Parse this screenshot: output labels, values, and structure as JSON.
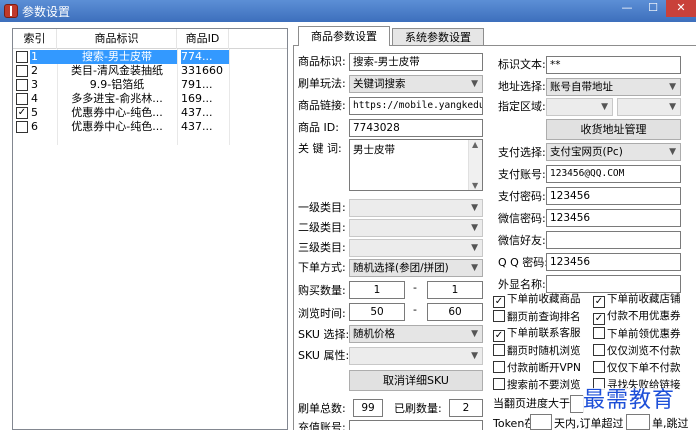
{
  "window": {
    "title": "参数设置",
    "min_glyph": "—",
    "max_glyph": "☐",
    "close_glyph": "✕"
  },
  "list": {
    "headers": {
      "index": "索引",
      "title": "商品标识",
      "id": "商品ID"
    },
    "rows": [
      {
        "checked": false,
        "index": "1",
        "title": "搜索-男士皮带",
        "id": "774...",
        "selected": true
      },
      {
        "checked": false,
        "index": "2",
        "title": "类目-清风金装抽纸",
        "id": "331660",
        "selected": false
      },
      {
        "checked": false,
        "index": "3",
        "title": "9.9-铝箔纸",
        "id": "791...",
        "selected": false
      },
      {
        "checked": false,
        "index": "4",
        "title": "多多进宝-俞兆林...",
        "id": "169...",
        "selected": false
      },
      {
        "checked": true,
        "index": "5",
        "title": "优惠券中心-纯色...",
        "id": "437...",
        "selected": false
      },
      {
        "checked": false,
        "index": "6",
        "title": "优惠券中心-纯色...",
        "id": "437...",
        "selected": false
      }
    ]
  },
  "tabs": [
    {
      "label": "商品参数设置",
      "active": true
    },
    {
      "label": "系统参数设置",
      "active": false
    }
  ],
  "form": {
    "product_tag_label": "商品标识:",
    "product_tag_value": "搜索-男士皮带",
    "play_mode_label": "刷单玩法:",
    "play_mode_value": "关键词搜索",
    "product_link_label": "商品链接:",
    "product_link_value": "https://mobile.yangkeduo.",
    "product_id_label": "商品   ID:",
    "product_id_value": "7743028",
    "keyword_label": "关 键 词:",
    "keyword_value": "男士皮带",
    "cat1_label": "一级类目:",
    "cat2_label": "二级类目:",
    "cat3_label": "三级类目:",
    "order_mode_label": "下单方式:",
    "order_mode_value": "随机选择(参团/拼团)",
    "buy_qty_label": "购买数量:",
    "buy_qty_min": "1",
    "buy_qty_max": "1",
    "browse_time_label": "浏览时间:",
    "browse_time_min": "50",
    "browse_time_max": "60",
    "dash": "-",
    "sku_select_label": "SKU 选择:",
    "sku_select_value": "随机价格",
    "sku_attr_label": "SKU 属性:",
    "cancel_sku_button": "取消详细SKU",
    "total_orders_label": "刷单总数:",
    "total_orders_value": "99",
    "done_orders_label": "已刷数量:",
    "done_orders_value": "2",
    "recharge_label": "充值账号:"
  },
  "right": {
    "mark_text_label": "标识文本:",
    "mark_text_value": "**",
    "address_label": "地址选择:",
    "address_value": "账号自带地址",
    "region_label": "指定区域:",
    "address_mgr_button": "收货地址管理",
    "pay_select_label": "支付选择:",
    "pay_select_value": "支付宝网页(Pc)",
    "pay_account_label": "支付账号:",
    "pay_account_value": "123456@QQ.COM",
    "pay_password_label": "支付密码:",
    "pay_password_value": "123456",
    "wechat_password_label": "微信密码:",
    "wechat_password_value": "123456",
    "wechat_friend_label": "微信好友:",
    "qq_password_label": "Q Q 密码:",
    "qq_password_value": "123456",
    "shop_name_label": "外显名称:"
  },
  "checks": [
    {
      "label": "下单前收藏商品",
      "checked": true
    },
    {
      "label": "下单前收藏店铺",
      "checked": true
    },
    {
      "label": "翻页前查询排名",
      "checked": false
    },
    {
      "label": "付款不用优惠券",
      "checked": true
    },
    {
      "label": "下单前联系客服",
      "checked": true
    },
    {
      "label": "下单前领优惠券",
      "checked": false
    },
    {
      "label": "翻页时随机浏览",
      "checked": false
    },
    {
      "label": "仅仅浏览不付款",
      "checked": false
    },
    {
      "label": "付款前断开VPN",
      "checked": false
    },
    {
      "label": "仅仅下单不付款",
      "checked": false
    },
    {
      "label": "搜索前不要浏览",
      "checked": false
    },
    {
      "label": "寻找失败给链接",
      "checked": false
    }
  ],
  "bottom": {
    "page_progress_label": "当翻页进度大于",
    "token_prefix": "Token在",
    "token_mid": "天内,订单超过",
    "token_suffix": "单,跳过"
  },
  "watermark": "最需教育"
}
